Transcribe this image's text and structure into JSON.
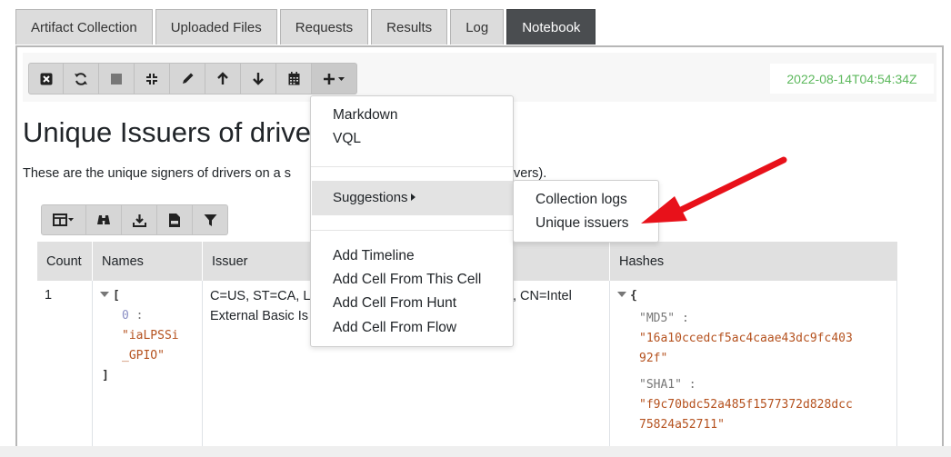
{
  "tabs": [
    {
      "label": "Artifact Collection"
    },
    {
      "label": "Uploaded Files"
    },
    {
      "label": "Requests"
    },
    {
      "label": "Results"
    },
    {
      "label": "Log"
    },
    {
      "label": "Notebook",
      "active": true
    }
  ],
  "toolbar": {
    "icons": [
      "close-icon",
      "refresh-icon",
      "stop-icon",
      "compress-icon",
      "pencil-icon",
      "arrow-up-icon",
      "arrow-down-icon",
      "calendar-icon",
      "plus-dropdown-icon"
    ]
  },
  "timestamp": "2022-08-14T04:54:34Z",
  "cell": {
    "heading": "Unique Issuers of drivers",
    "paragraph_left": "These are the unique signers of drivers on a s",
    "paragraph_right": "vers)."
  },
  "table_toolbar": {
    "icons": [
      "columns-icon",
      "binoculars-icon",
      "download-icon",
      "csv-icon",
      "filter-icon"
    ]
  },
  "table": {
    "headers": [
      "Count",
      "Names",
      "Issuer",
      "Hashes"
    ],
    "row": {
      "count": "1",
      "names_open": "[",
      "names_index": "0",
      "names_colon": ":",
      "names_value_line1": "\"iaLPSSi",
      "names_value_line2": "_GPIO\"",
      "names_close": "]",
      "issuer_line1_left": "C=US, ST=CA, L=",
      "issuer_line1_right": "n, CN=Intel",
      "issuer_line2_left": "External Basic Is",
      "hashes_open": "{",
      "md5_key": "\"MD5\"",
      "md5_colon": ":",
      "md5_line1": "\"16a10ccedcf5ac4caae43dc9fc403",
      "md5_line2": "92f\"",
      "sha1_key": "\"SHA1\"",
      "sha1_colon": ":",
      "sha1_line1": "\"f9c70bdc52a485f1577372d828dcc",
      "sha1_line2": "75824a52711\""
    }
  },
  "add_menu": {
    "markdown": "Markdown",
    "vql": "VQL",
    "suggestions": "Suggestions",
    "add_timeline": "Add Timeline",
    "add_cell_from_this_cell": "Add Cell From This Cell",
    "add_cell_from_hunt": "Add Cell From Hunt",
    "add_cell_from_flow": "Add Cell From Flow"
  },
  "suggestions_menu": {
    "collection_logs": "Collection logs",
    "unique_issuers": "Unique issuers"
  },
  "colors": {
    "timestamp": "#5cb85c",
    "arrow": "#e8111a",
    "active_tab": "#4a4d50"
  }
}
